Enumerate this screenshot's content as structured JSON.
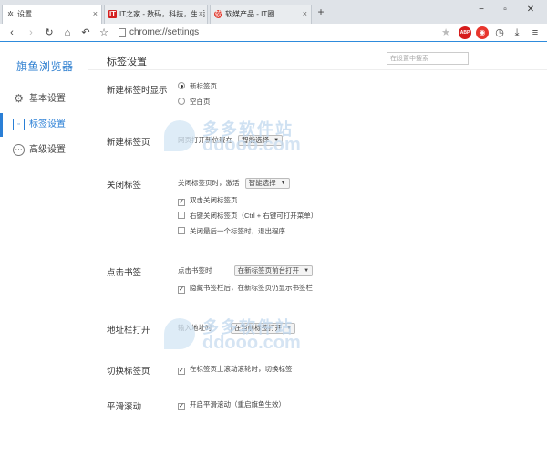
{
  "tabs": [
    {
      "title": "设置",
      "icon": "gear-icon"
    },
    {
      "title": "IT之家 - 数码，科技，生活",
      "icon": "ithome-icon"
    },
    {
      "title": "软媒产品 - IT圈",
      "icon": "ruanmei-icon"
    }
  ],
  "address_bar": {
    "url": "chrome://settings"
  },
  "sidebar": {
    "brand": "旗鱼浏览器",
    "items": [
      {
        "label": "基本设置",
        "active": false
      },
      {
        "label": "标签设置",
        "active": true
      },
      {
        "label": "高级设置",
        "active": false
      }
    ]
  },
  "main": {
    "title": "标签设置",
    "search_placeholder": "在设置中搜索",
    "sections": {
      "new_tab_show": {
        "label": "新建标签时显示",
        "options": [
          {
            "label": "新标签页",
            "selected": true
          },
          {
            "label": "空白页",
            "selected": false
          }
        ]
      },
      "new_tab_page": {
        "label": "新建标签页",
        "text": "网页打开新位置在",
        "select": "智能选择"
      },
      "close_tab": {
        "label": "关闭标签",
        "text": "关闭标签页时，激活",
        "select": "智能选择",
        "options": [
          {
            "label": "双击关闭标签页",
            "checked": true
          },
          {
            "label": "右键关闭标签页（Ctrl + 右键可打开菜单）",
            "checked": false
          },
          {
            "label": "关闭最后一个标签时，退出程序",
            "checked": false
          }
        ]
      },
      "bookmark": {
        "label": "点击书签",
        "text": "点击书签时",
        "select": "在新标签页前台打开",
        "option": {
          "label": "隐藏书签栏后，在新标签页仍显示书签栏",
          "checked": true
        }
      },
      "address_open": {
        "label": "地址栏打开",
        "text": "输入地址时",
        "select": "在当前标签打开"
      },
      "switch_tab": {
        "label": "切换标签页",
        "option": {
          "label": "在标签页上滚动滚轮时，切换标签",
          "checked": true
        }
      },
      "smooth_scroll": {
        "label": "平滑滚动",
        "option": {
          "label": "开启平滑滚动（重启旗鱼生效）",
          "checked": true
        }
      }
    }
  },
  "watermark": {
    "cn": "多多软件站",
    "en": "ddooo.com"
  }
}
